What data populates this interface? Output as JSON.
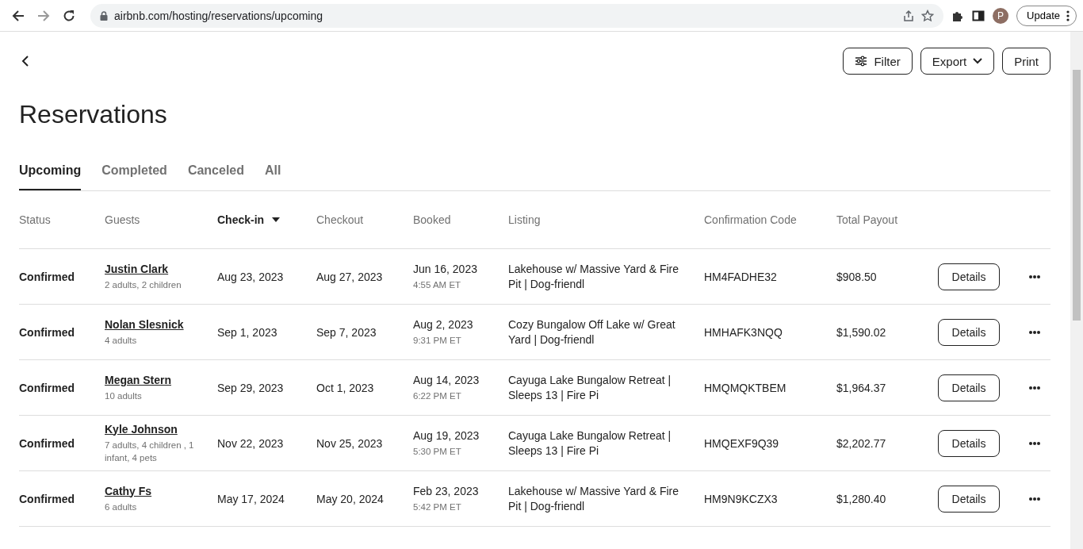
{
  "browser": {
    "url": "airbnb.com/hosting/reservations/upcoming",
    "profile_initial": "P",
    "update_button": "Update"
  },
  "toolbar": {
    "buttons": [
      {
        "label": "Filter",
        "kind": "filter"
      },
      {
        "label": "Export",
        "kind": "dropdown"
      },
      {
        "label": "Print",
        "kind": "plain"
      }
    ]
  },
  "title": "Reservations",
  "tabs": [
    {
      "label": "Upcoming",
      "selected": true
    },
    {
      "label": "Completed",
      "selected": false
    },
    {
      "label": "Canceled",
      "selected": false
    },
    {
      "label": "All",
      "selected": false
    }
  ],
  "table": {
    "columns": [
      {
        "label": "Status",
        "sorted": false
      },
      {
        "label": "Guests",
        "sorted": false
      },
      {
        "label": "Check-in",
        "sorted": true
      },
      {
        "label": "Checkout",
        "sorted": false
      },
      {
        "label": "Booked",
        "sorted": false
      },
      {
        "label": "Listing",
        "sorted": false
      },
      {
        "label": "Confirmation Code",
        "sorted": false
      },
      {
        "label": "Total Payout",
        "sorted": false
      }
    ],
    "rows": [
      {
        "status": "Confirmed",
        "guest": "Justin Clark",
        "guest_detail": "2 adults, 2 children",
        "check_in": "Aug 23, 2023",
        "checkout": "Aug 27, 2023",
        "booked_date": "Jun 16, 2023",
        "booked_time": "4:55 AM ET",
        "listing": "Lakehouse w/ Massive Yard & Fire Pit | Dog-friendl",
        "code": "HM4FADHE32",
        "payout": "$908.50",
        "action": "Details"
      },
      {
        "status": "Confirmed",
        "guest": "Nolan Slesnick",
        "guest_detail": "4 adults",
        "check_in": "Sep 1, 2023",
        "checkout": "Sep 7, 2023",
        "booked_date": "Aug 2, 2023",
        "booked_time": "9:31 PM ET",
        "listing": "Cozy Bungalow Off Lake w/ Great Yard | Dog-friendl",
        "code": "HMHAFK3NQQ",
        "payout": "$1,590.02",
        "action": "Details"
      },
      {
        "status": "Confirmed",
        "guest": "Megan Stern",
        "guest_detail": "10 adults",
        "check_in": "Sep 29, 2023",
        "checkout": "Oct 1, 2023",
        "booked_date": "Aug 14, 2023",
        "booked_time": "6:22 PM ET",
        "listing": "Cayuga Lake Bungalow Retreat | Sleeps 13 | Fire Pi",
        "code": "HMQMQKTBEM",
        "payout": "$1,964.37",
        "action": "Details"
      },
      {
        "status": "Confirmed",
        "guest": "Kyle Johnson",
        "guest_detail": "7 adults, 4 children , 1 infant, 4 pets",
        "check_in": "Nov 22, 2023",
        "checkout": "Nov 25, 2023",
        "booked_date": "Aug 19, 2023",
        "booked_time": "5:30 PM ET",
        "listing": "Cayuga Lake Bungalow Retreat | Sleeps 13 | Fire Pi",
        "code": "HMQEXF9Q39",
        "payout": "$2,202.77",
        "action": "Details"
      },
      {
        "status": "Confirmed",
        "guest": "Cathy Fs",
        "guest_detail": "6 adults",
        "check_in": "May 17, 2024",
        "checkout": "May 20, 2024",
        "booked_date": "Feb 23, 2023",
        "booked_time": "5:42 PM ET",
        "listing": "Lakehouse w/ Massive Yard & Fire Pit | Dog-friendl",
        "code": "HM9N9KCZX3",
        "payout": "$1,280.40",
        "action": "Details"
      }
    ]
  }
}
